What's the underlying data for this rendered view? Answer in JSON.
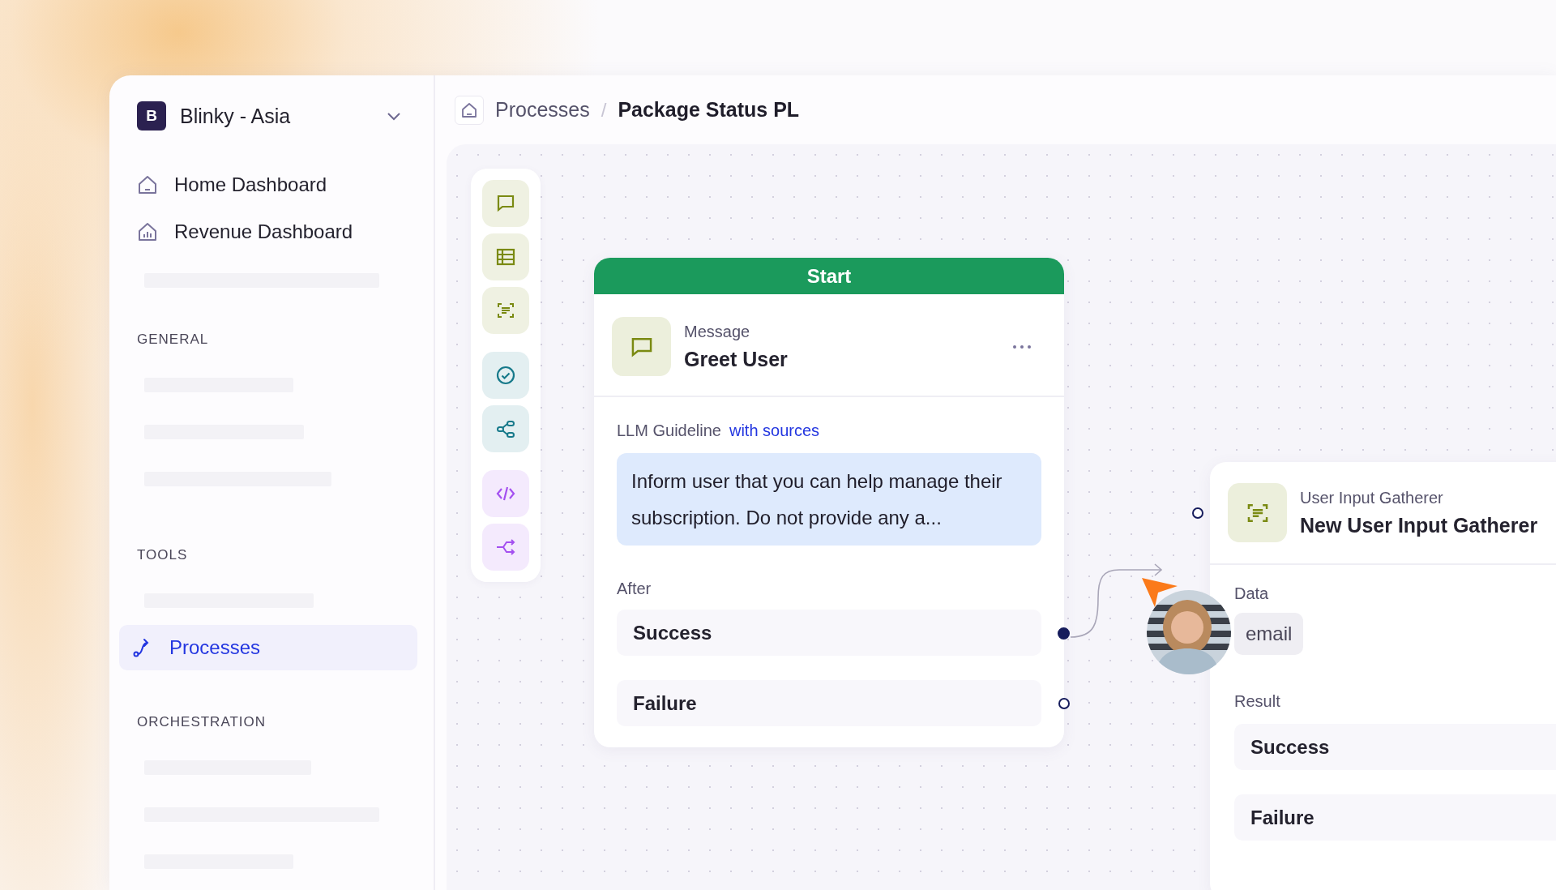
{
  "sidebar": {
    "workspace": {
      "initial": "B",
      "name": "Blinky - Asia"
    },
    "top_items": [
      {
        "kind": "home",
        "label": "Home Dashboard",
        "selected": false
      },
      {
        "kind": "revenue",
        "label": "Revenue Dashboard",
        "selected": false
      },
      {
        "kind": "placeholder"
      }
    ],
    "sections": [
      {
        "title": "GENERAL",
        "items": [
          {
            "kind": "placeholder"
          },
          {
            "kind": "placeholder"
          },
          {
            "kind": "placeholder"
          }
        ]
      },
      {
        "title": "TOOLS",
        "items": [
          {
            "kind": "placeholder"
          },
          {
            "kind": "processes",
            "label": "Processes",
            "selected": true
          }
        ]
      },
      {
        "title": "ORCHESTRATION",
        "items": [
          {
            "kind": "placeholder"
          },
          {
            "kind": "placeholder"
          },
          {
            "kind": "placeholder"
          }
        ]
      }
    ]
  },
  "breadcrumb": {
    "separator": "/",
    "items": [
      "Processes",
      "Package Status PL"
    ]
  },
  "toolbar": [
    {
      "kind": "message",
      "color": "#7a8a12"
    },
    {
      "kind": "table",
      "color": "#7a8a12"
    },
    {
      "kind": "gatherer",
      "color": "#7a8a12"
    },
    {
      "kind": "check",
      "color": "#16798a"
    },
    {
      "kind": "branch",
      "color": "#16798a"
    },
    {
      "kind": "code",
      "color": "#a450f0"
    },
    {
      "kind": "split",
      "color": "#a450f0"
    }
  ],
  "start_node": {
    "header": "Start",
    "type": "Message",
    "title": "Greet User",
    "guideline_label": "LLM Guideline",
    "guideline_link": "with sources",
    "guideline": "Inform user that you can help manage their subscription. Do not provide any a...",
    "after_label": "After",
    "outcomes": [
      {
        "label": "Success",
        "connected": true
      },
      {
        "label": "Failure",
        "connected": false
      }
    ]
  },
  "gatherer_node": {
    "type": "User Input Gatherer",
    "title": "New User Input Gatherer",
    "data_label": "Data",
    "data": [
      "email"
    ],
    "result_label": "Result",
    "outcomes": [
      {
        "label": "Success"
      },
      {
        "label": "Failure"
      }
    ]
  }
}
